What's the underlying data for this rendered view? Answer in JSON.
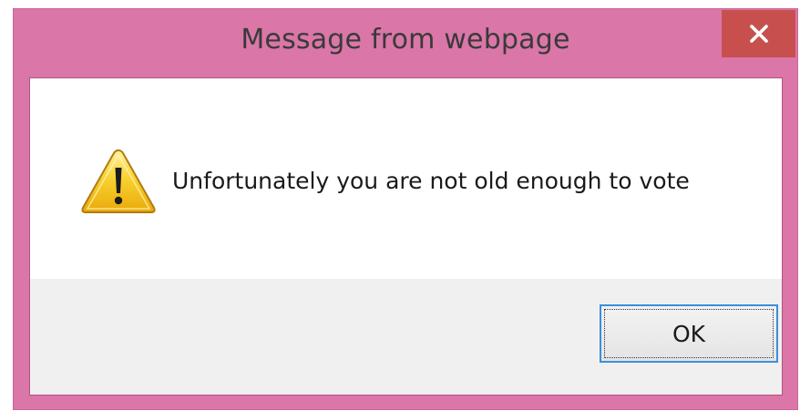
{
  "window": {
    "title": "Message from webpage",
    "close_glyph": "✕",
    "close_icon": "close-icon",
    "frame_color": "#db76a8",
    "close_color": "#c7504f"
  },
  "content": {
    "icon": "warning-icon",
    "message": "Unfortunately you are not old enough to vote"
  },
  "buttons": {
    "ok_label": "OK",
    "focus_color": "#3c8edb"
  }
}
